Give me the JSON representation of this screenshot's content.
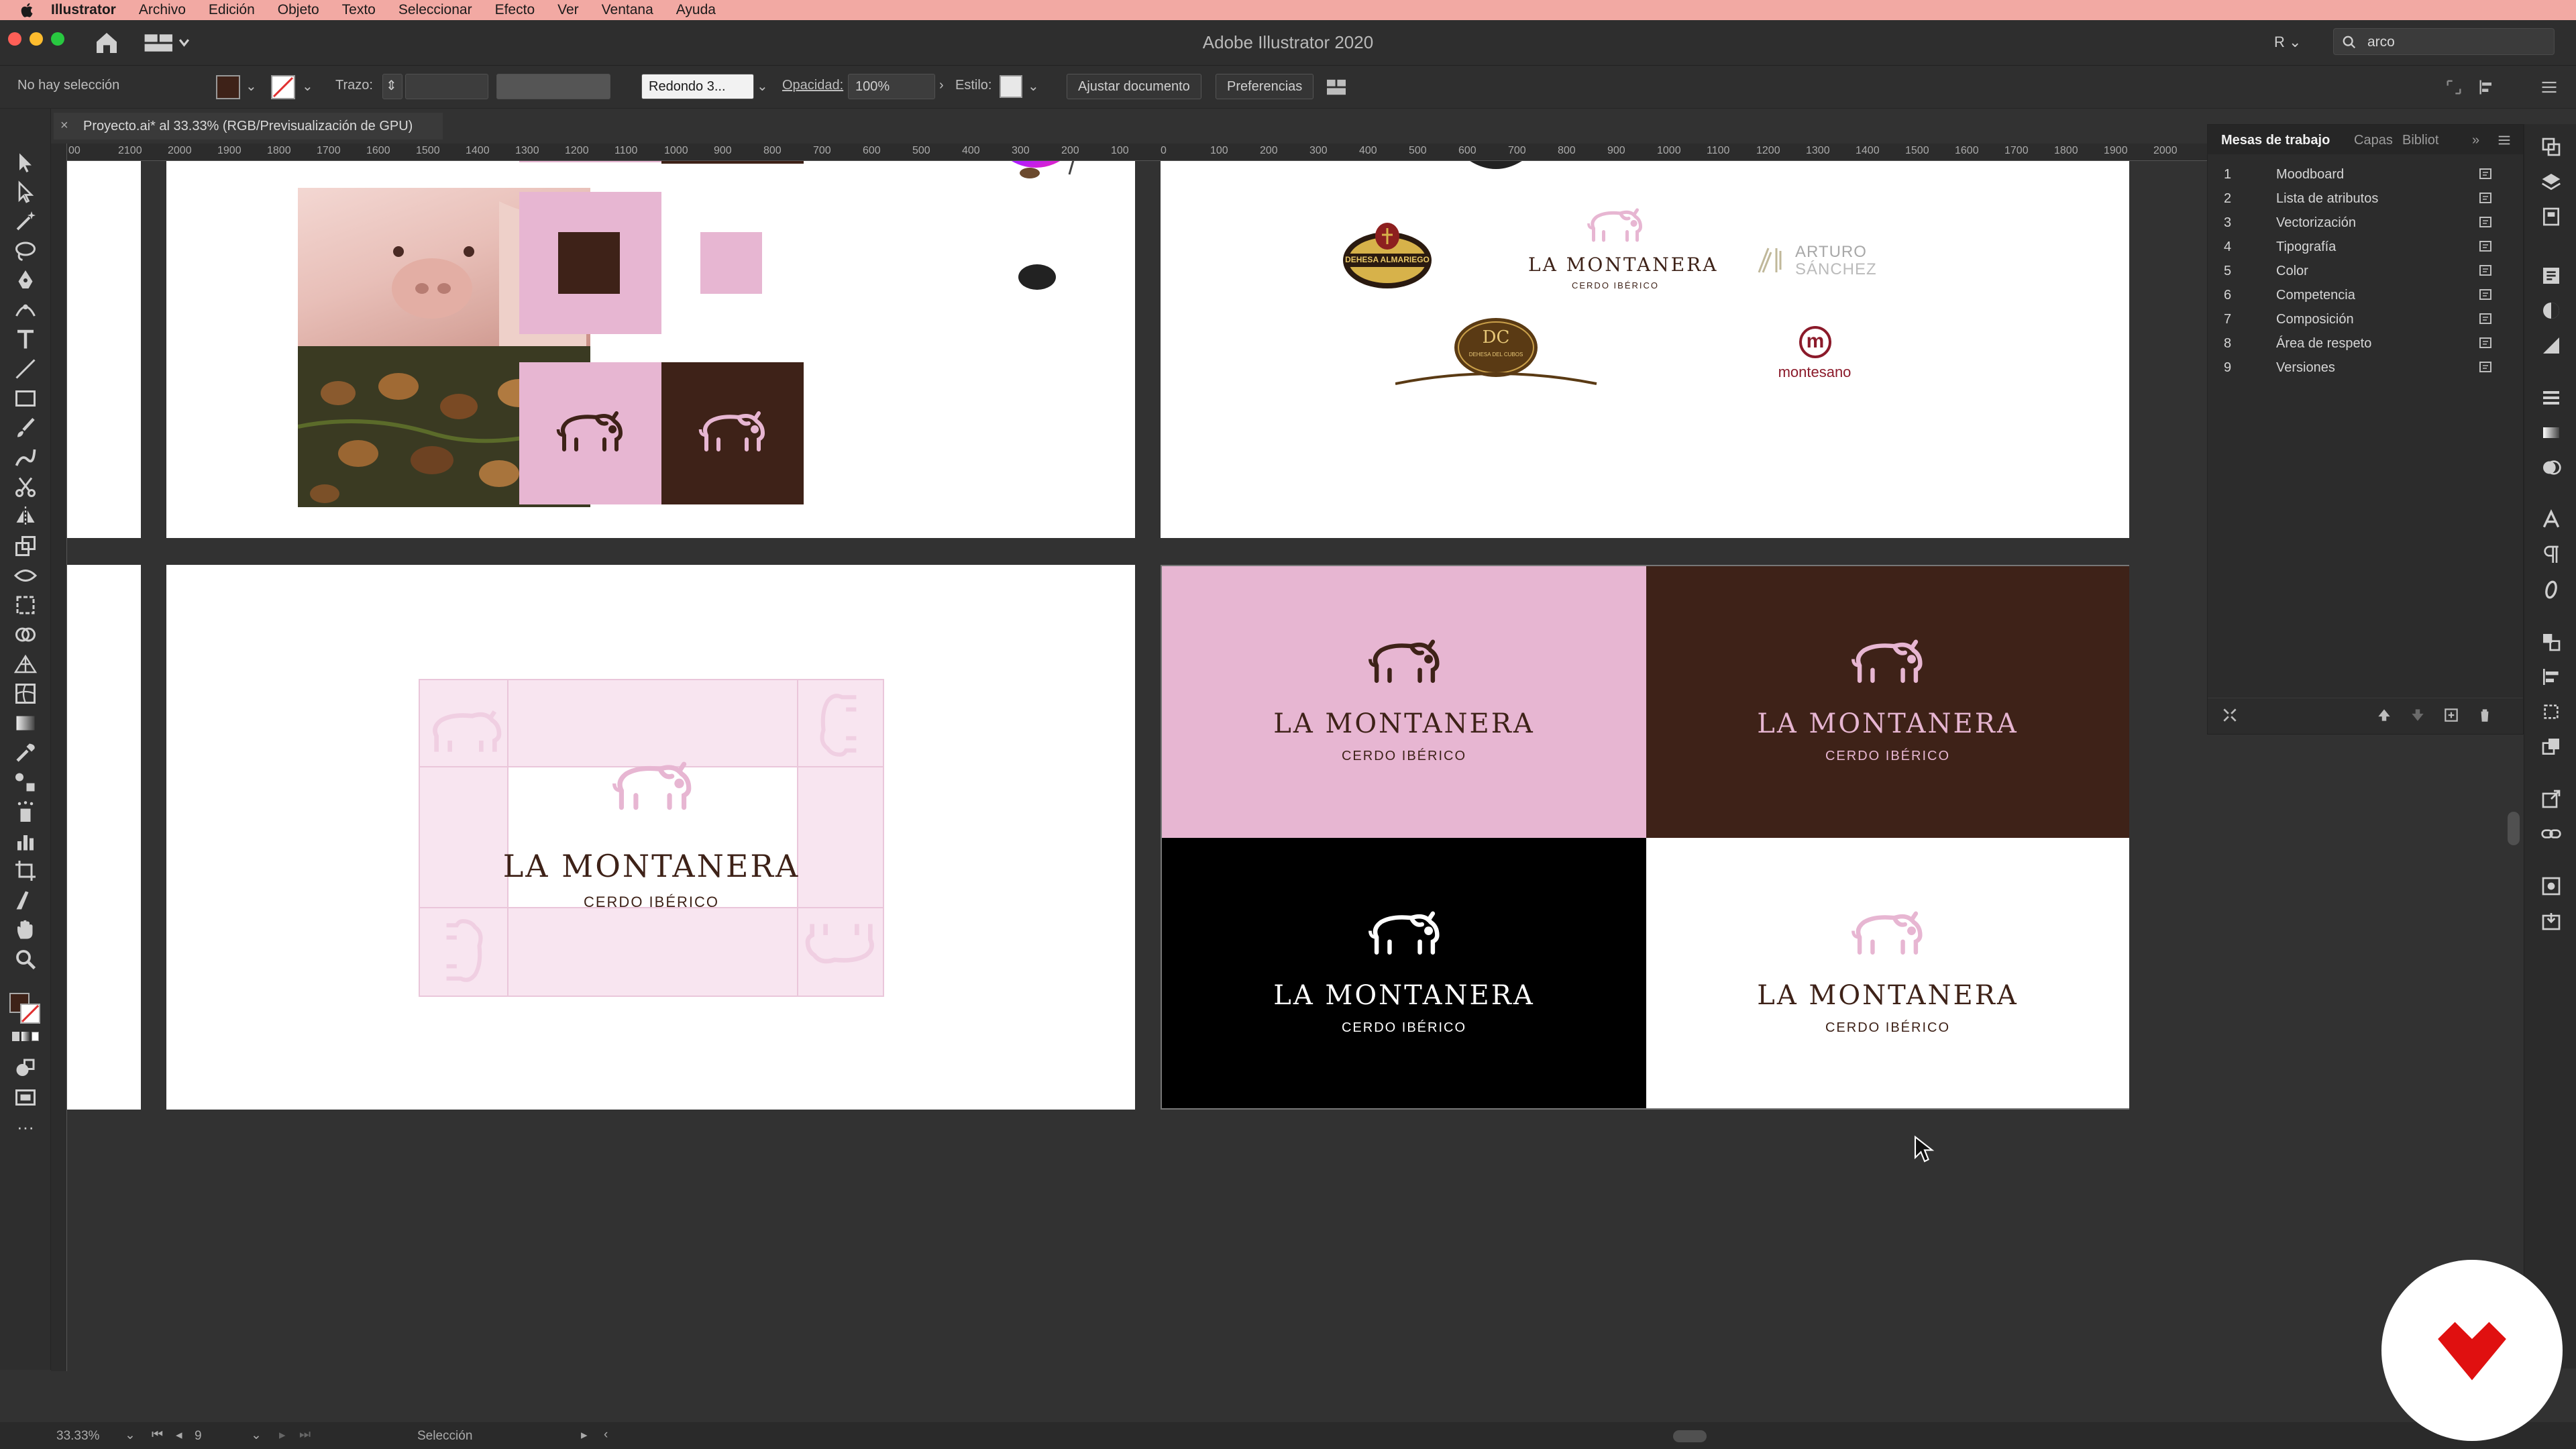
{
  "menubar": {
    "items": [
      "Illustrator",
      "Archivo",
      "Edición",
      "Objeto",
      "Texto",
      "Seleccionar",
      "Efecto",
      "Ver",
      "Ventana",
      "Ayuda"
    ]
  },
  "titlebar": {
    "title": "Adobe Illustrator 2020",
    "user_initial": "R",
    "search_value": "arco"
  },
  "controlbar": {
    "selection": "No hay selección",
    "stroke_label": "Trazo:",
    "brush": "Redondo 3...",
    "opacity_label": "Opacidad:",
    "opacity_value": "100%",
    "style_label": "Estilo:",
    "fit_doc": "Ajustar documento",
    "prefs": "Preferencias"
  },
  "doctab": {
    "title": "Proyecto.ai* al 33.33% (RGB/Previsualización de GPU)",
    "close": "×"
  },
  "ruler": {
    "labels": [
      "00",
      "2100",
      "2000",
      "1900",
      "1800",
      "1700",
      "1600",
      "1500",
      "1400",
      "1300",
      "1200",
      "1100",
      "1000",
      "900",
      "800",
      "700",
      "600",
      "500",
      "400",
      "300",
      "200",
      "100",
      "0",
      "100",
      "200",
      "300",
      "400",
      "500",
      "600",
      "700",
      "800",
      "900",
      "1000",
      "1100",
      "1200",
      "1300",
      "1400",
      "1500",
      "1600",
      "1700",
      "1800",
      "1900",
      "2000"
    ]
  },
  "panel": {
    "tabs": [
      "Mesas de trabajo",
      "Capas",
      "Bibliot"
    ],
    "artboards": [
      {
        "n": "1",
        "name": "Moodboard"
      },
      {
        "n": "2",
        "name": "Lista de atributos"
      },
      {
        "n": "3",
        "name": "Vectorización"
      },
      {
        "n": "4",
        "name": "Tipografía"
      },
      {
        "n": "5",
        "name": "Color"
      },
      {
        "n": "6",
        "name": "Competencia"
      },
      {
        "n": "7",
        "name": "Composición"
      },
      {
        "n": "8",
        "name": "Área de respeto"
      },
      {
        "n": "9",
        "name": "Versiones"
      }
    ]
  },
  "canvas": {
    "brand": "LA MONTANERA",
    "tagline": "CERDO IBÉRICO",
    "competitors": {
      "dehesa": "DEHESA ALMARIEGO",
      "arturo_1": "ARTURO",
      "arturo_2": "SÁNCHEZ",
      "montesano": "montesano",
      "montesano_m": "m",
      "dehesa_cubos_1": "DC",
      "dehesa_cubos_2": "DEHESA DEL CUBOS"
    },
    "colors": {
      "pink": "#e7b6d2",
      "brown": "#3e2218",
      "black": "#000000",
      "white": "#ffffff",
      "light_pink": "#f8e5f0"
    }
  },
  "statusbar": {
    "zoom": "33.33%",
    "page": "9",
    "tool": "Selección"
  }
}
